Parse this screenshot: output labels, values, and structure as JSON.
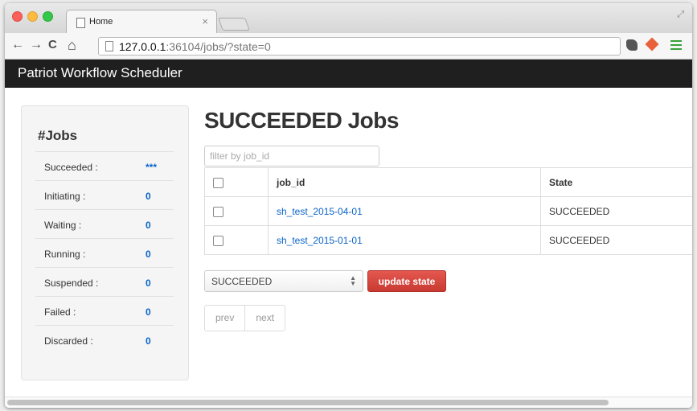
{
  "browser": {
    "tab_title": "Home",
    "tab_close": "×",
    "url_host": "127.0.0.1",
    "url_rest": ":36104/jobs/?state=0",
    "nav": {
      "back": "←",
      "forward": "→",
      "reload": "C",
      "home": "⌂"
    }
  },
  "app": {
    "brand": "Patriot Workflow Scheduler"
  },
  "sidebar": {
    "title": "#Jobs",
    "rows": [
      {
        "label": "Succeeded :",
        "count": "***"
      },
      {
        "label": "Initiating :",
        "count": "0"
      },
      {
        "label": "Waiting :",
        "count": "0"
      },
      {
        "label": "Running :",
        "count": "0"
      },
      {
        "label": "Suspended :",
        "count": "0"
      },
      {
        "label": "Failed :",
        "count": "0"
      },
      {
        "label": "Discarded :",
        "count": "0"
      }
    ]
  },
  "main": {
    "title": "SUCCEEDED Jobs",
    "filter_placeholder": "filter by job_id",
    "table": {
      "headers": [
        "job_id",
        "State"
      ],
      "rows": [
        {
          "job_id": "sh_test_2015-04-01",
          "state": "SUCCEEDED"
        },
        {
          "job_id": "sh_test_2015-01-01",
          "state": "SUCCEEDED"
        }
      ]
    },
    "state_select": "SUCCEEDED",
    "update_button": "update state",
    "pager": {
      "prev": "prev",
      "next": "next"
    }
  },
  "colors": {
    "navbar": "#1f1f1f",
    "link": "#0a64c8",
    "danger": "#d9534f"
  }
}
